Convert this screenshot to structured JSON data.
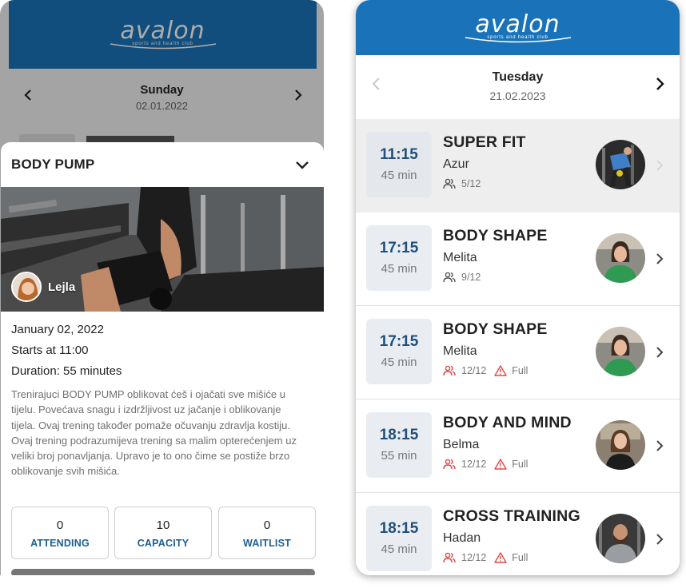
{
  "brand": {
    "name": "avalon",
    "tagline": "sports and health club",
    "color": "#1a73b8"
  },
  "left": {
    "day": "Sunday",
    "date": "02.01.2022",
    "sheet": {
      "title": "BODY PUMP",
      "trainer": "Lejla",
      "date_line": "January 02, 2022",
      "start_line": "Starts at 11:00",
      "duration_line": "Duration: 55 minutes",
      "description": "Trenirajuci BODY PUMP oblikovat ćeš i ojačati sve mišiće u tijelu. Povećava snagu i izdržljivost uz jačanje i oblikovanje tijela. Ovaj trening također pomaže očuvanju zdravlja kostiju. Ovaj trening podrazumijeva trening sa malim opterećenjem uz veliki broj ponavljanja. Upravo je to ono čime se postiže brzo oblikovanje svih mišića.",
      "stats": [
        {
          "value": "0",
          "label": "ATTENDING"
        },
        {
          "value": "10",
          "label": "CAPACITY"
        },
        {
          "value": "0",
          "label": "WAITLIST"
        }
      ]
    }
  },
  "right": {
    "day": "Tuesday",
    "date": "21.02.2023",
    "classes": [
      {
        "time": "11:15",
        "duration": "45 min",
        "name": "SUPER FIT",
        "trainer": "Azur",
        "count": "5/12",
        "full": "",
        "status": "available",
        "selected": true
      },
      {
        "time": "17:15",
        "duration": "45 min",
        "name": "BODY SHAPE",
        "trainer": "Melita",
        "count": "9/12",
        "full": "",
        "status": "available",
        "selected": false
      },
      {
        "time": "17:15",
        "duration": "45 min",
        "name": "BODY SHAPE",
        "trainer": "Melita",
        "count": "12/12",
        "full": "Full",
        "status": "full",
        "selected": false
      },
      {
        "time": "18:15",
        "duration": "55 min",
        "name": "BODY AND MIND",
        "trainer": "Belma",
        "count": "12/12",
        "full": "Full",
        "status": "full",
        "selected": false
      },
      {
        "time": "18:15",
        "duration": "45 min",
        "name": "CROSS TRAINING",
        "trainer": "Hadan",
        "count": "12/12",
        "full": "Full",
        "status": "full",
        "selected": false
      }
    ]
  },
  "colors": {
    "full_red": "#e04848",
    "time_blue": "#1f4f7a",
    "label_blue": "#1a5f95"
  }
}
